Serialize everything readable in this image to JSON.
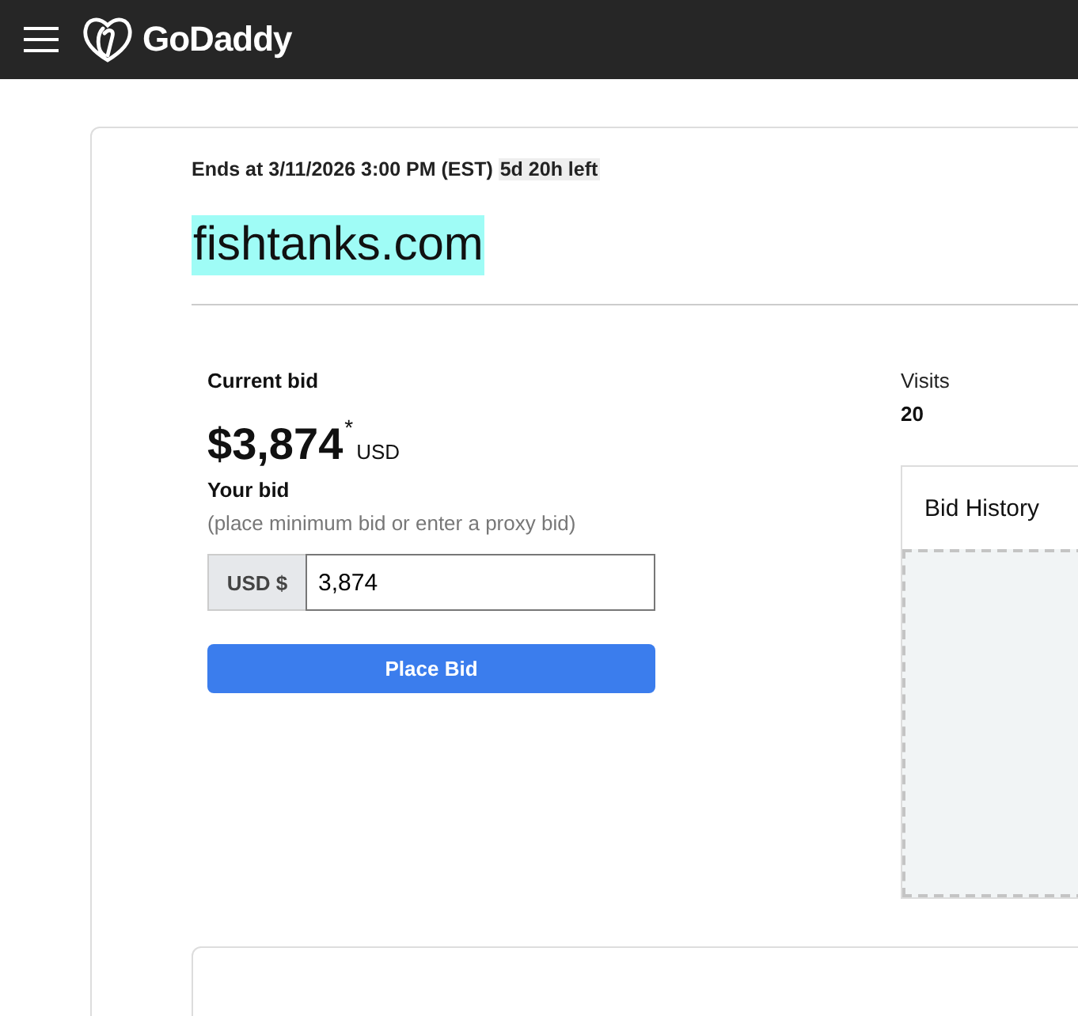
{
  "header": {
    "logo_text": "GoDaddy"
  },
  "auction": {
    "ends_at": "Ends at 3/11/2026 3:00 PM (EST)",
    "time_left": "5d 20h left",
    "domain": "fishtanks.com"
  },
  "bid": {
    "current_label": "Current bid",
    "price": "$3,874",
    "price_mark": "*",
    "currency": "USD",
    "your_bid_label": "Your bid",
    "hint": "(place minimum bid or enter a proxy bid)",
    "prefix": "USD $",
    "value": "3,874",
    "button": "Place Bid"
  },
  "stats": {
    "visits_label": "Visits",
    "visits": "20",
    "history_title": "Bid History"
  }
}
